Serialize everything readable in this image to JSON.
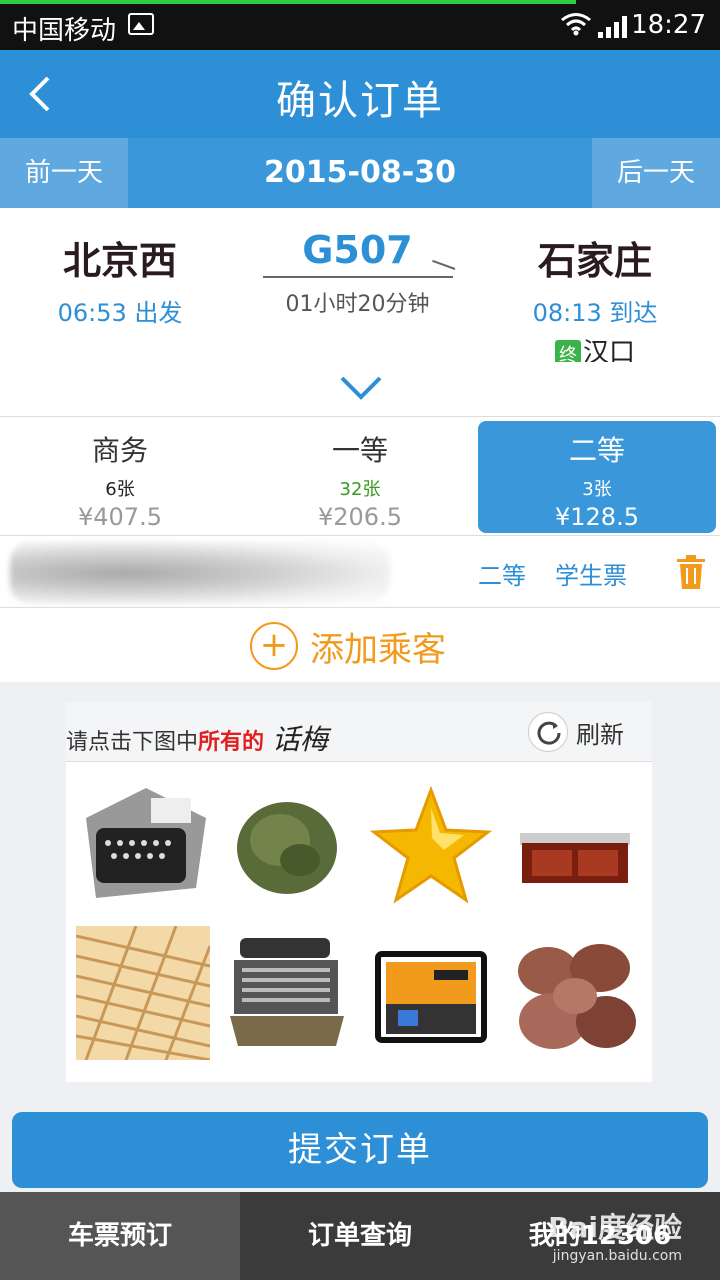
{
  "status_bar": {
    "carrier": "中国移动",
    "time": "18:27",
    "load_progress": 0.8
  },
  "header": {
    "title": "确认订单"
  },
  "date_bar": {
    "prev_label": "前一天",
    "date": "2015-08-30",
    "next_label": "后一天"
  },
  "train": {
    "from_station": "北京西",
    "depart_time": "06:53 出发",
    "code": "G507",
    "duration": "01小时20分钟",
    "to_station": "石家庄",
    "arrive_time": "08:13 到达",
    "terminal_tag": "终",
    "terminal_station": "汉口"
  },
  "seats": [
    {
      "name": "商务",
      "count": "6张",
      "price": "¥407.5",
      "selected": false
    },
    {
      "name": "一等",
      "count": "32张",
      "price": "¥206.5",
      "selected": false
    },
    {
      "name": "二等",
      "count": "3张",
      "price": "¥128.5",
      "selected": true
    }
  ],
  "passenger": {
    "seat_type": "二等",
    "ticket_type": "学生票"
  },
  "add_passenger": {
    "label": "添加乘客"
  },
  "captcha": {
    "prompt_prefix": "请点击下图中",
    "prompt_emphasis": "所有的",
    "prompt_word": "话梅",
    "refresh_label": "刷新",
    "images": [
      "typewriter",
      "tea-leaves",
      "star",
      "red-furniture",
      "toothpicks",
      "old-typewriter",
      "generator",
      "dried-plums"
    ]
  },
  "submit": {
    "label": "提交订单"
  },
  "bottom_nav": {
    "items": [
      "车票预订",
      "订单查询",
      "我的12306"
    ],
    "active_index": 0
  },
  "watermark": {
    "main": "Bai度经验",
    "sub": "jingyan.baidu.com"
  },
  "colors": {
    "primary": "#2d8fd6",
    "accent_orange": "#f29a1b",
    "selected_seat": "#3a97da"
  }
}
